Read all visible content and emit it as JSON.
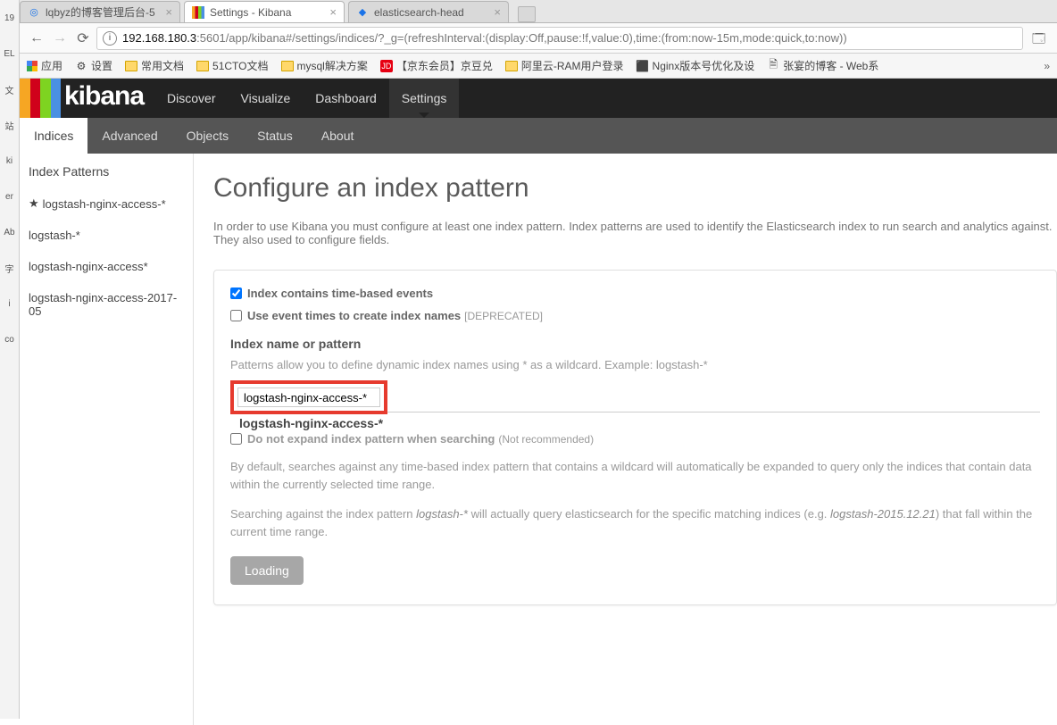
{
  "leftstrip": [
    "19",
    "EL",
    "文",
    "站",
    "ki",
    "er",
    "Ab",
    "字",
    "i",
    "co"
  ],
  "browser": {
    "tabs": [
      {
        "favicon": "🔵",
        "title": "lqbyz的博客管理后台-5",
        "active": false
      },
      {
        "favicon": "||",
        "title": "Settings - Kibana",
        "active": true
      },
      {
        "favicon": "🔷",
        "title": "elasticsearch-head",
        "active": false
      }
    ],
    "url_host": "192.168.180.3",
    "url_port": ":5601",
    "url_path": "/app/kibana#/settings/indices/?_g=(refreshInterval:(display:Off,pause:!f,value:0),time:(from:now-15m,mode:quick,to:now))",
    "bookmarks": [
      {
        "icon": "apps",
        "label": "应用"
      },
      {
        "icon": "gear",
        "label": "设置"
      },
      {
        "icon": "folder",
        "label": "常用文档"
      },
      {
        "icon": "folder",
        "label": "51CTO文档"
      },
      {
        "icon": "folder",
        "label": "mysql解决方案"
      },
      {
        "icon": "jd",
        "label": "【京东会员】京豆兑"
      },
      {
        "icon": "folder",
        "label": "阿里云-RAM用户登录"
      },
      {
        "icon": "nginx",
        "label": "Nginx版本号优化及设"
      },
      {
        "icon": "page",
        "label": "张宴的博客 - Web系"
      }
    ]
  },
  "kibana": {
    "nav": [
      {
        "label": "Discover"
      },
      {
        "label": "Visualize"
      },
      {
        "label": "Dashboard"
      },
      {
        "label": "Settings",
        "active": true
      }
    ],
    "subnav": [
      {
        "label": "Indices",
        "active": true
      },
      {
        "label": "Advanced"
      },
      {
        "label": "Objects"
      },
      {
        "label": "Status"
      },
      {
        "label": "About"
      }
    ],
    "side": {
      "header": "Index Patterns",
      "items": [
        {
          "star": true,
          "label": "logstash-nginx-access-*"
        },
        {
          "star": false,
          "label": "logstash-*"
        },
        {
          "star": false,
          "label": "logstash-nginx-access*"
        },
        {
          "star": false,
          "label": "logstash-nginx-access-2017-05"
        }
      ]
    },
    "main": {
      "title": "Configure an index pattern",
      "intro": "In order to use Kibana you must configure at least one index pattern. Index patterns are used to identify the Elasticsearch index to run search and analytics against. They also used to configure fields.",
      "chk1": "Index contains time-based events",
      "chk2": "Use event times to create index names",
      "chk2_dep": "[DEPRECATED]",
      "lbl_name": "Index name or pattern",
      "hint_name": "Patterns allow you to define dynamic index names using * as a wildcard. Example: logstash-*",
      "input_value": "logstash-nginx-access-*",
      "suggestion": "logstash-nginx-access-*",
      "chk3": "Do not expand index pattern when searching",
      "chk3_note": "(Not recommended)",
      "para1_a": "By default, searches against any time-based index pattern that contains a wildcard will automatically be expanded to query only the indices that contain data within the currently selected time range.",
      "para2_a": "Searching against the index pattern ",
      "para2_em1": "logstash-*",
      "para2_b": " will actually query elasticsearch for the specific matching indices (e.g. ",
      "para2_em2": "logstash-2015.12.21",
      "para2_c": ") that fall within the current time range.",
      "loading": "Loading"
    }
  }
}
